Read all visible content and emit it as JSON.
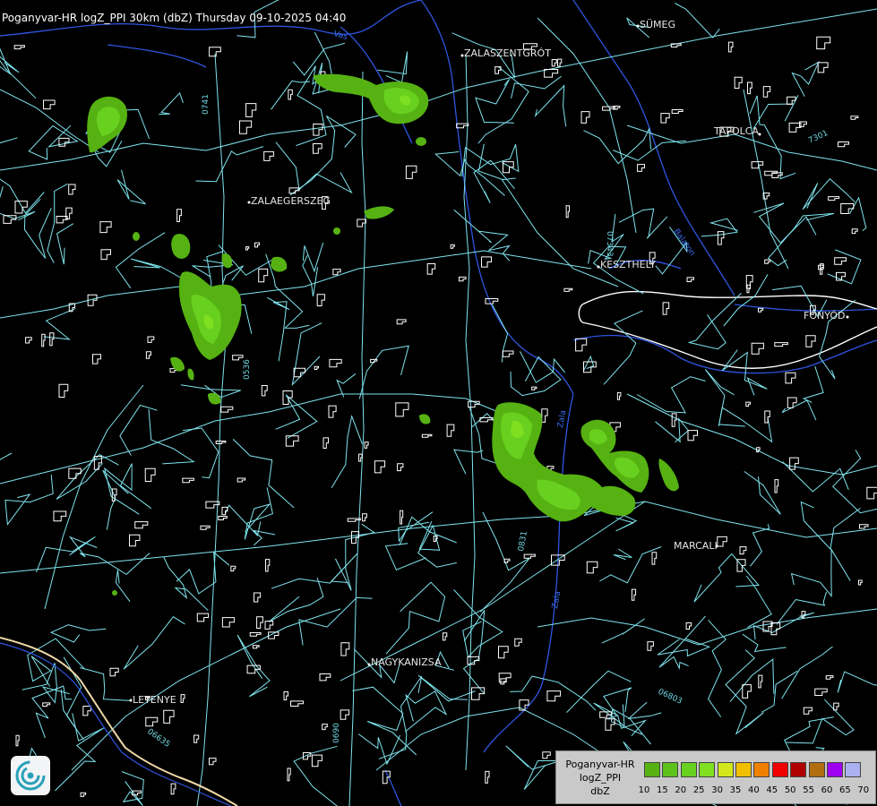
{
  "title": "Poganyvar-HR logZ_PPI 30km (dbZ) Thursday 09-10-2025 04:40",
  "towns": [
    {
      "id": "sumeg",
      "name": "SÜMEG"
    },
    {
      "id": "zalaszentgrot",
      "name": "ZALASZENTGRÓT"
    },
    {
      "id": "tapolca",
      "name": "TAPOLCA"
    },
    {
      "id": "zalaegerszeg",
      "name": "ZALAEGERSZEG"
    },
    {
      "id": "keszthely",
      "name": "KESZTHELY"
    },
    {
      "id": "fonyod",
      "name": "FONYÓD"
    },
    {
      "id": "marcali",
      "name": "MARCALI"
    },
    {
      "id": "nagykanizsa",
      "name": "NAGYKANIZSA"
    },
    {
      "id": "letenye",
      "name": "LETENYE"
    }
  ],
  "road_labels": [
    "0741",
    "07343",
    "7301",
    "0536",
    "0831",
    "06803",
    "0690",
    "06635"
  ],
  "river_labels": [
    "Vas",
    "Zala",
    "Balaton",
    "Zala"
  ],
  "legend": {
    "station": "Poganyvar-HR",
    "product": "logZ_PPI",
    "unit": "dbZ",
    "ticks": [
      "10",
      "15",
      "20",
      "25",
      "30",
      "35",
      "40",
      "45",
      "50",
      "55",
      "60",
      "65",
      "70"
    ],
    "colors": [
      "#56b212",
      "#5ec21c",
      "#68d01e",
      "#7ee020",
      "#d2e81a",
      "#f0c000",
      "#f08000",
      "#f00000",
      "#b00000",
      "#b06e10",
      "#a000f0",
      "#aab0f0"
    ]
  },
  "map_colors": {
    "background": "#000000",
    "roads": "#7fe5ee",
    "rivers": "#2f55e0",
    "boundaries": "#ffffff",
    "border": "#f0d8a8"
  },
  "logo_icon": "weather-service-swirl-icon"
}
